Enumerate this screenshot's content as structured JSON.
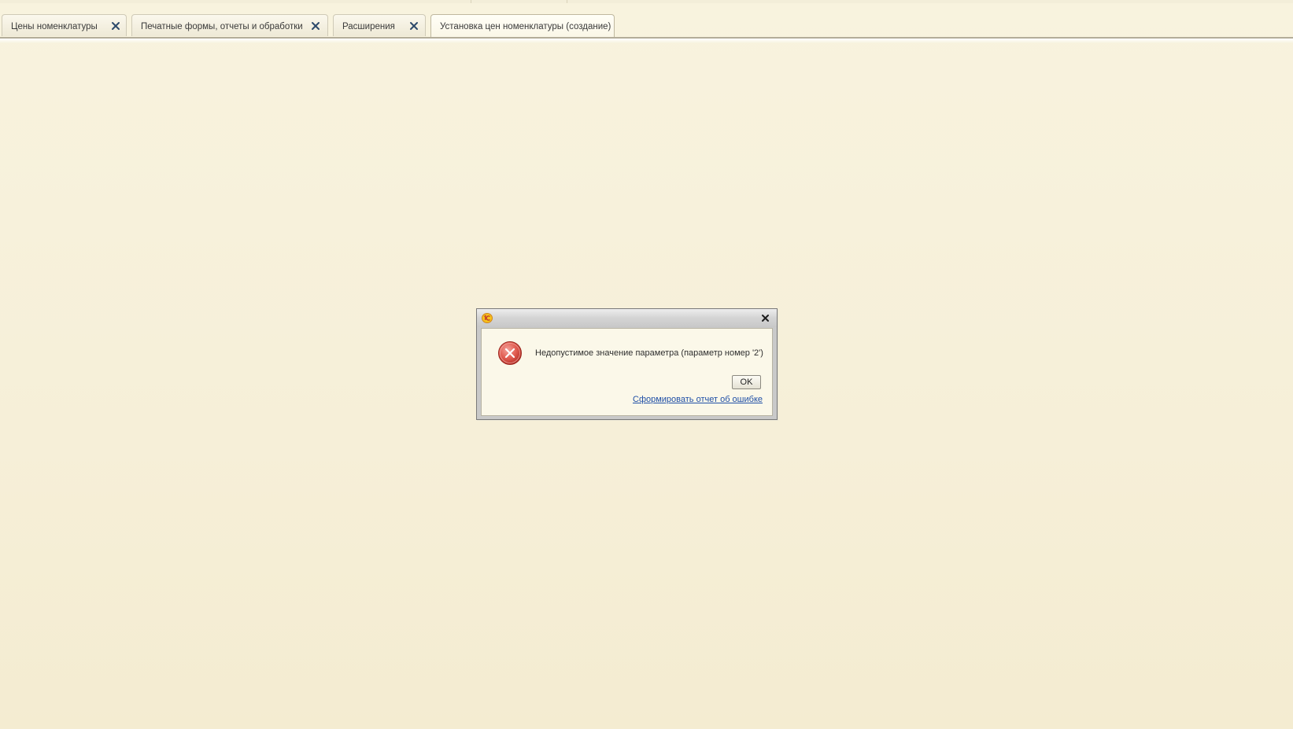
{
  "tabs": [
    {
      "label": "Цены номенклатуры",
      "closable": true,
      "active": false
    },
    {
      "label": "Печатные формы, отчеты и обработки",
      "closable": true,
      "active": false
    },
    {
      "label": "Расширения",
      "closable": true,
      "active": false
    },
    {
      "label": "Установка цен номенклатуры (создание)",
      "closable": false,
      "active": true
    }
  ],
  "dialog": {
    "app_icon": "1c-logo-icon",
    "close_icon": "close-icon",
    "status_icon": "error-icon",
    "message": "Недопустимое значение параметра (параметр номер '2')",
    "ok_label": "OK",
    "report_link": "Сформировать отчет об ошибке"
  },
  "colors": {
    "background": "#f7f1da",
    "error_red": "#d9534f",
    "link": "#1f4fa6",
    "tab_close": "#2d4a6b"
  }
}
